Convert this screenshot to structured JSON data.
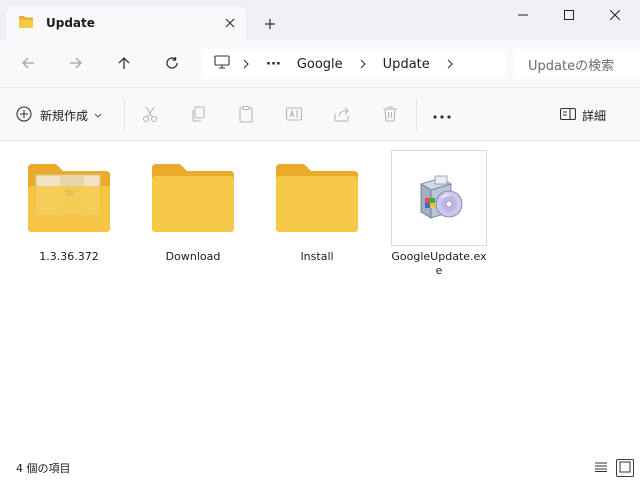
{
  "tab": {
    "title": "Update",
    "close_icon": "close-icon",
    "folder_icon": "folder-icon"
  },
  "window": {
    "new_tab_icon": "plus-icon",
    "minimize_icon": "minimize-icon",
    "maximize_icon": "maximize-icon",
    "close_icon": "close-icon"
  },
  "nav": {
    "back_icon": "arrow-left-icon",
    "forward_icon": "arrow-right-icon",
    "up_icon": "arrow-up-icon",
    "refresh_icon": "refresh-icon",
    "breadcrumb": [
      "Google",
      "Update"
    ],
    "overflow": "···",
    "search_placeholder": "Updateの検索"
  },
  "toolbar": {
    "new_label": "新規作成",
    "details_label": "詳細",
    "more_label": "···",
    "icons": [
      "cut-icon",
      "copy-icon",
      "paste-icon",
      "rename-icon",
      "share-icon",
      "delete-icon"
    ]
  },
  "items": [
    {
      "name": "1.3.36.372",
      "type": "folder-with-content"
    },
    {
      "name": "Download",
      "type": "folder"
    },
    {
      "name": "Install",
      "type": "folder"
    },
    {
      "name": "GoogleUpdate.exe",
      "type": "exe",
      "selected": true
    }
  ],
  "status": {
    "text": "4 個の項目"
  },
  "colors": {
    "folder": "#f7c948",
    "folder_back": "#e9ac2a",
    "accent": "#0067c0"
  }
}
